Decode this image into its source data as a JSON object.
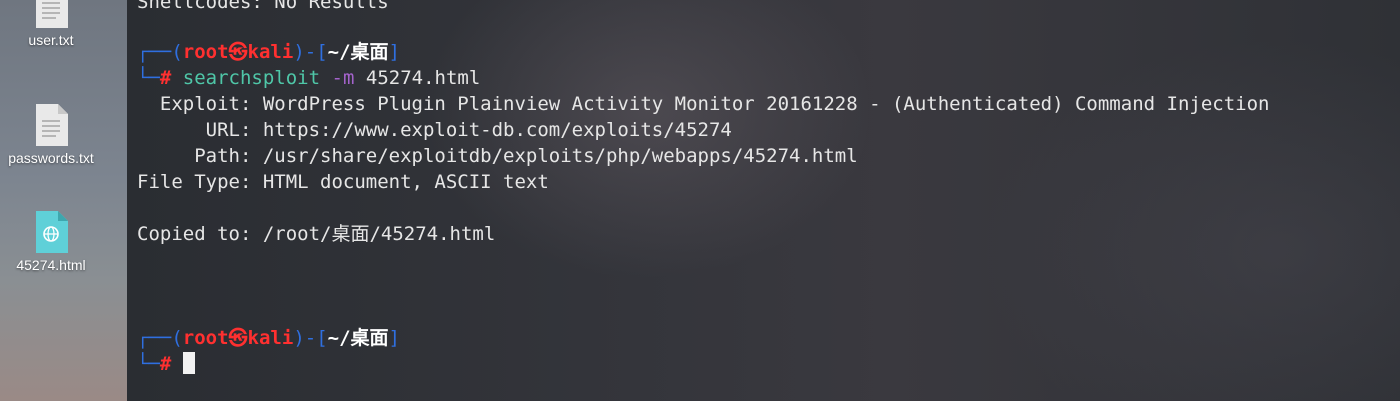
{
  "desktop": {
    "icons": [
      {
        "name": "user.txt",
        "icon": "text-file-icon"
      },
      {
        "name": "passwords.txt",
        "icon": "text-file-icon"
      },
      {
        "name": "45274.html",
        "icon": "html-file-icon"
      }
    ]
  },
  "terminal": {
    "top_partial": "Shellcodes: No Results",
    "prompt1": {
      "corner_top": "┌──(",
      "user_host_user": "root",
      "user_host_sep": "㉿",
      "user_host_host": "kali",
      "mid": ")-[",
      "dir": "~/桌面",
      "end": "]",
      "corner_bottom": "└─",
      "hash": "#",
      "cmd_name": "searchsploit",
      "cmd_flag": "-m",
      "cmd_arg": "45274.html"
    },
    "output": [
      "  Exploit: WordPress Plugin Plainview Activity Monitor 20161228 - (Authenticated) Command Injection",
      "      URL: https://www.exploit-db.com/exploits/45274",
      "     Path: /usr/share/exploitdb/exploits/php/webapps/45274.html",
      "File Type: HTML document, ASCII text",
      "",
      "Copied to: /root/桌面/45274.html"
    ],
    "prompt2": {
      "corner_top": "┌──(",
      "user_host_user": "root",
      "user_host_sep": "㉿",
      "user_host_host": "kali",
      "mid": ")-[",
      "dir": "~/桌面",
      "end": "]",
      "corner_bottom": "└─",
      "hash": "#"
    }
  },
  "colors": {
    "prompt_blue": "#2f6fe0",
    "prompt_red": "#ff3030",
    "command_green": "#4fc7a8",
    "flag_purple": "#a463cc"
  }
}
